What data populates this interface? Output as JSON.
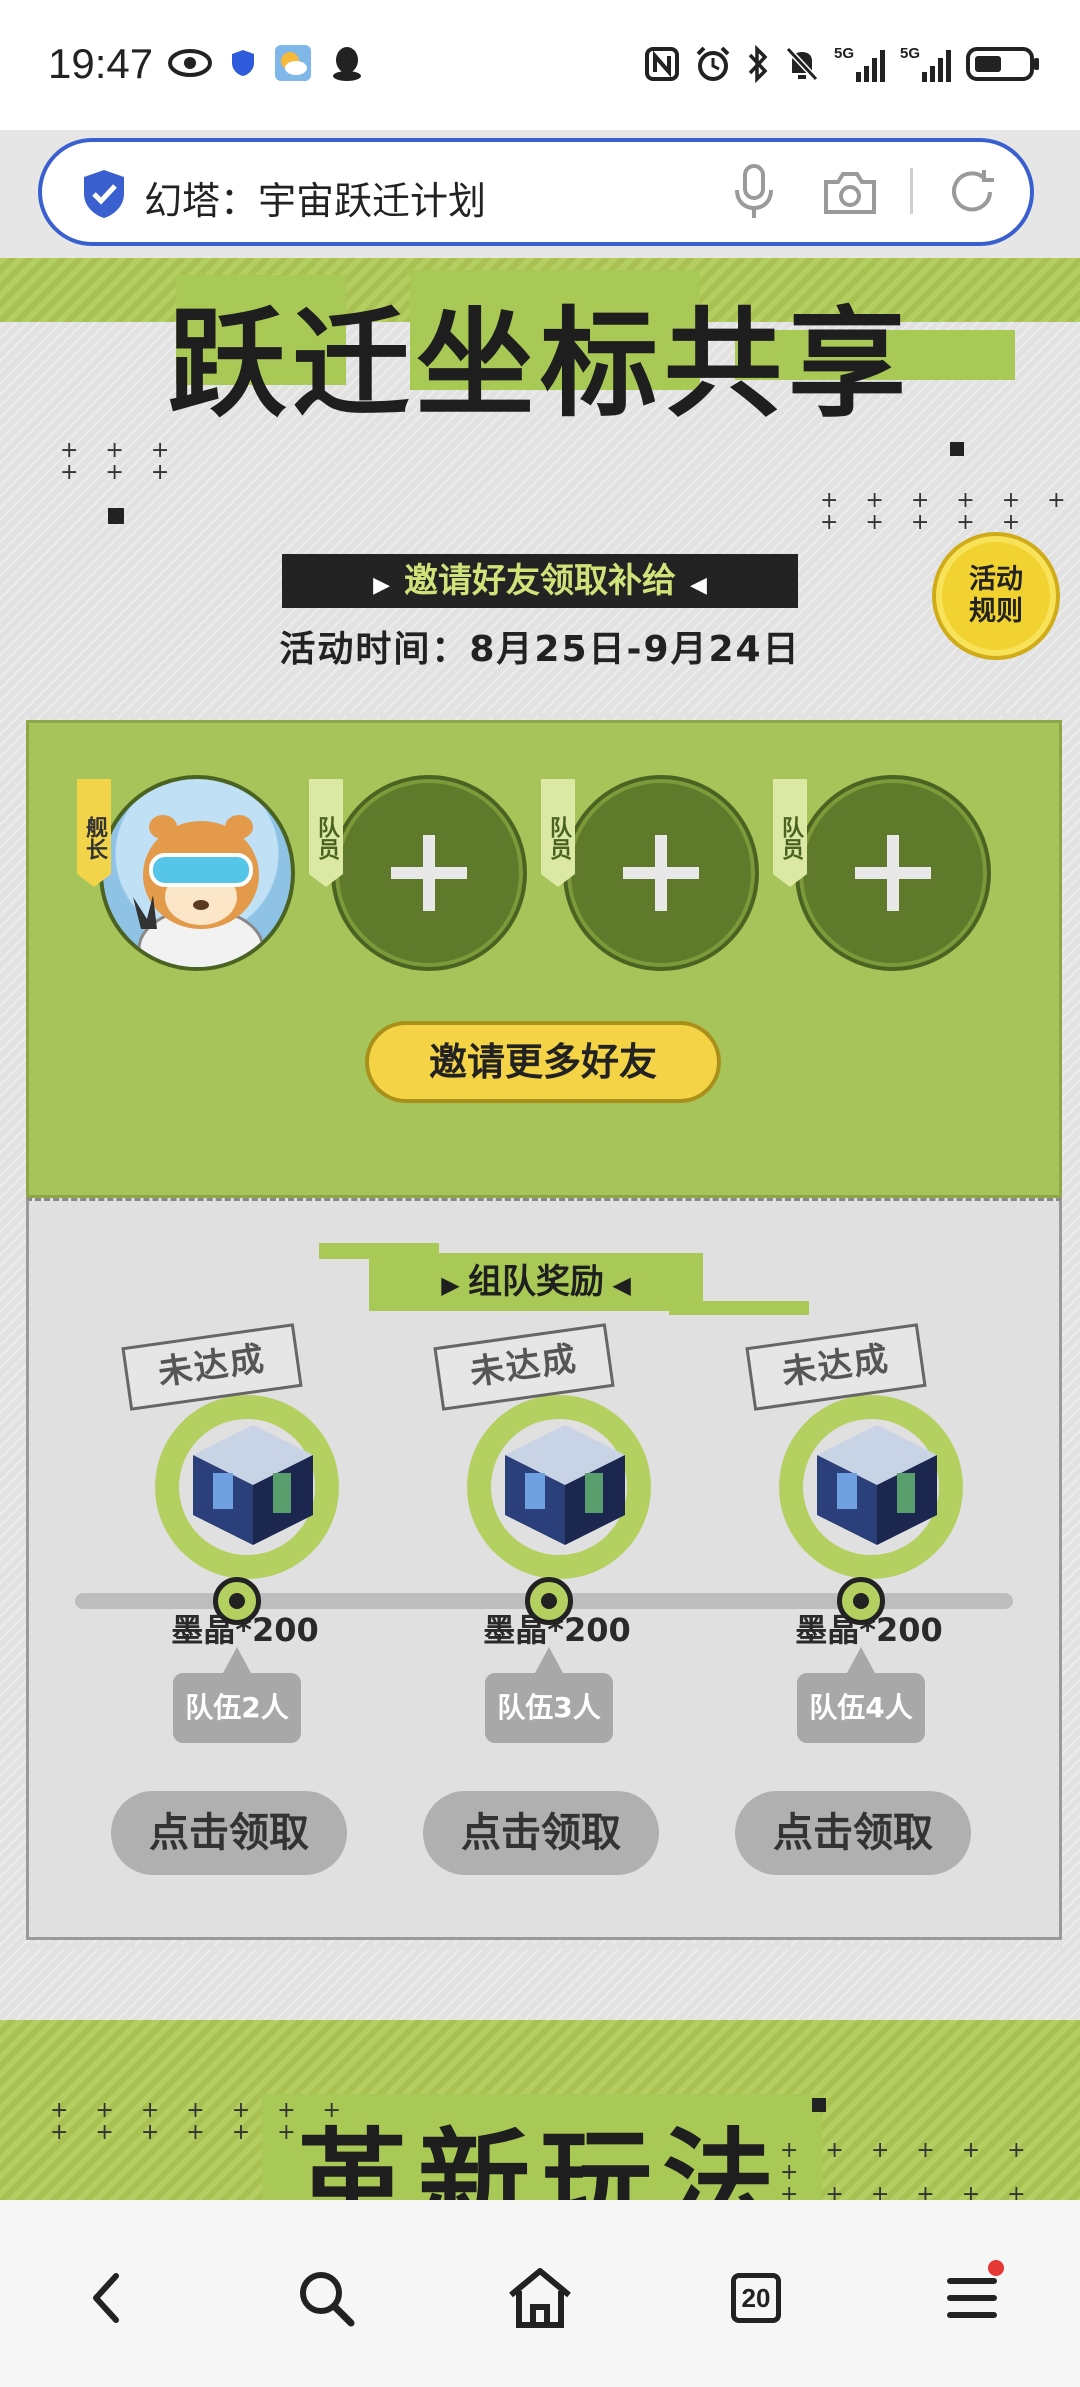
{
  "status_bar": {
    "time": "19:47",
    "left_icons": [
      "eye-icon",
      "shield-icon",
      "weather-app-icon",
      "qq-icon"
    ],
    "right_icons": [
      "nfc-icon",
      "alarm-icon",
      "bluetooth-icon",
      "mute-icon",
      "signal-5g-icon",
      "signal-5g-icon",
      "battery-icon"
    ]
  },
  "address_bar": {
    "title": "幻塔：宇宙跃迁计划",
    "icons": [
      "verified-shield-icon",
      "microphone-icon",
      "camera-icon",
      "reload-icon"
    ]
  },
  "hero": {
    "title": "跃迁坐标共享",
    "subtitle": "邀请好友领取补给",
    "event_time": "活动时间：8月25日-9月24日",
    "rules_button_line1": "活动",
    "rules_button_line2": "规则"
  },
  "team": {
    "slots": [
      {
        "role": "舰长",
        "type": "captain"
      },
      {
        "role": "队员",
        "type": "empty"
      },
      {
        "role": "队员",
        "type": "empty"
      },
      {
        "role": "队员",
        "type": "empty"
      }
    ],
    "invite_button": "邀请更多好友"
  },
  "rewards": {
    "title": "组队奖励",
    "items": [
      {
        "status": "未达成",
        "amount": "墨晶*200",
        "team_label": "队伍2人",
        "claim": "点击领取"
      },
      {
        "status": "未达成",
        "amount": "墨晶*200",
        "team_label": "队伍3人",
        "claim": "点击领取"
      },
      {
        "status": "未达成",
        "amount": "墨晶*200",
        "team_label": "队伍4人",
        "claim": "点击领取"
      }
    ]
  },
  "next_section": {
    "title": "革新玩法"
  },
  "nav_bar": {
    "tab_count": "20",
    "icons": [
      "back-icon",
      "search-icon",
      "home-icon",
      "tabs-icon",
      "menu-icon"
    ]
  },
  "colors": {
    "accent_green": "#a9c956",
    "accent_yellow": "#f4d446",
    "address_border": "#3a5fcf",
    "notification_red": "#e53935"
  }
}
